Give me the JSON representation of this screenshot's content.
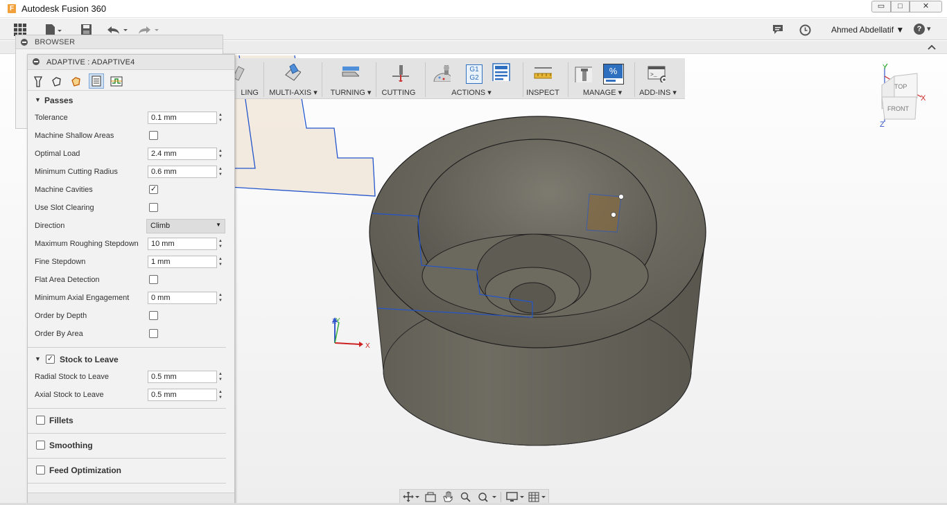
{
  "window": {
    "title": "Autodesk Fusion 360",
    "logo_letter": "F",
    "minimize": "▭",
    "maximize": "□",
    "close": "✕"
  },
  "quick_access": {
    "user_name": "Ahmed Abdellatif ▼",
    "help": "?",
    "help_caret": "▾"
  },
  "browser": {
    "title": "BROWSER"
  },
  "ribbon": {
    "groups": [
      {
        "label": "LING",
        "icon": "milling-icon"
      },
      {
        "label": "MULTI-AXIS ▾",
        "icon": "multi-axis-icon"
      },
      {
        "label": "TURNING ▾",
        "icon": "turning-icon"
      },
      {
        "label": "CUTTING",
        "icon": "cutting-icon"
      },
      {
        "label": "ACTIONS ▾",
        "icon": "actions-icon"
      },
      {
        "label": "INSPECT",
        "icon": "inspect-icon"
      },
      {
        "label": "MANAGE ▾",
        "icon": "manage-icon"
      },
      {
        "label": "ADD-INS ▾",
        "icon": "add-ins-icon"
      }
    ],
    "g1g2_top": "G1",
    "g1g2_bottom": "G2",
    "percent": "%"
  },
  "dialog": {
    "title": "ADAPTIVE : ADAPTIVE4",
    "passes": {
      "title": "Passes",
      "tolerance": {
        "label": "Tolerance",
        "value": "0.1 mm"
      },
      "machine_shallow": {
        "label": "Machine Shallow Areas",
        "checked": false
      },
      "optimal_load": {
        "label": "Optimal Load",
        "value": "2.4 mm"
      },
      "min_cutting_radius": {
        "label": "Minimum Cutting Radius",
        "value": "0.6 mm"
      },
      "machine_cavities": {
        "label": "Machine Cavities",
        "checked": true,
        "mark": "✓"
      },
      "use_slot_clearing": {
        "label": "Use Slot Clearing",
        "checked": false
      },
      "direction": {
        "label": "Direction",
        "value": "Climb"
      },
      "max_roughing_stepdown": {
        "label": "Maximum Roughing Stepdown",
        "value": "10 mm"
      },
      "fine_stepdown": {
        "label": "Fine Stepdown",
        "value": "1 mm"
      },
      "flat_area_detection": {
        "label": "Flat Area Detection",
        "checked": false
      },
      "min_axial_engagement": {
        "label": "Minimum Axial Engagement",
        "value": "0 mm"
      },
      "order_by_depth": {
        "label": "Order by Depth",
        "checked": false
      },
      "order_by_area": {
        "label": "Order By Area",
        "checked": false
      }
    },
    "stock_to_leave": {
      "title": "Stock to Leave",
      "checked": true,
      "mark": "✓",
      "radial": {
        "label": "Radial Stock to Leave",
        "value": "0.5 mm"
      },
      "axial": {
        "label": "Axial Stock to Leave",
        "value": "0.5 mm"
      }
    },
    "fillets": {
      "title": "Fillets",
      "checked": false
    },
    "smoothing": {
      "title": "Smoothing",
      "checked": false
    },
    "feed_optimization": {
      "title": "Feed Optimization",
      "checked": false
    }
  },
  "viewcube": {
    "top": "TOP",
    "front": "FRONT",
    "x": "X",
    "y": "Y",
    "z": "Z"
  },
  "triad": {
    "x": "X",
    "y": "Y",
    "z": "Z"
  }
}
